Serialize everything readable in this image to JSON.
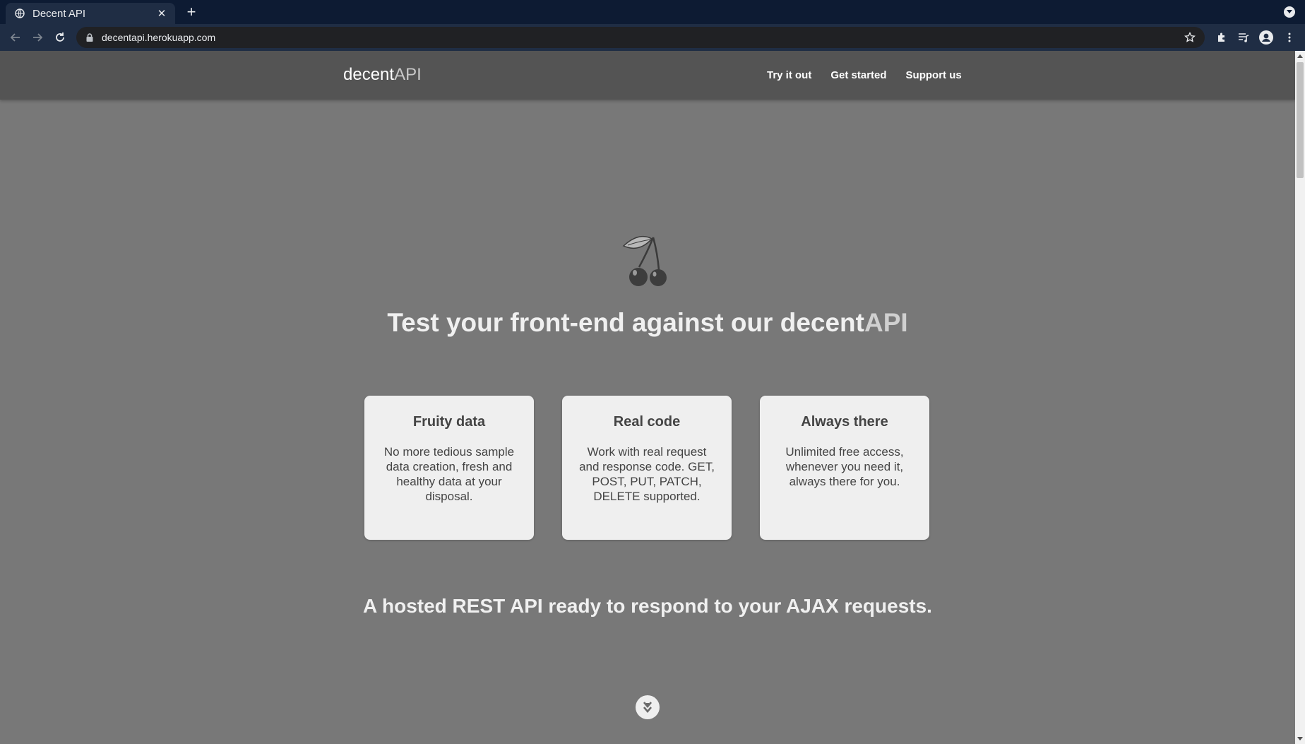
{
  "browser": {
    "tab_title": "Decent API",
    "tab_close": "✕",
    "new_tab": "+",
    "url": "decentapi.herokuapp.com"
  },
  "site": {
    "brand_main": "decent",
    "brand_accent": "API",
    "nav": [
      "Try it out",
      "Get started",
      "Support us"
    ],
    "hero_title_main": "Test your front-end against our decent",
    "hero_title_accent": "API",
    "cards": [
      {
        "title": "Fruity data",
        "body": "No more tedious sample data creation, fresh and healthy data at your disposal."
      },
      {
        "title": "Real code",
        "body": "Work with real request and response code. GET, POST, PUT, PATCH, DELETE supported."
      },
      {
        "title": "Always there",
        "body": "Unlimited free access, whenever you need it, always there for you."
      }
    ],
    "tagline": "A hosted REST API ready to respond to your AJAX requests."
  },
  "icons": {
    "hero": "cherry-icon",
    "scroll": "double-chevron-down-icon"
  },
  "colors": {
    "page_bg": "#787878",
    "nav_bg": "#545454",
    "card_bg": "#efefef",
    "browser_tabstrip": "#0d1b33",
    "browser_toolbar": "#1f2d44"
  }
}
